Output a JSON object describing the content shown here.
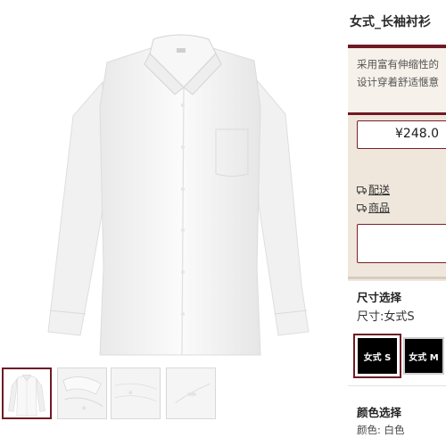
{
  "product": {
    "title": "女式_长袖衬衫",
    "description_line1": "采用富有伸缩性的",
    "description_line2": "设计穿着舒适惬意",
    "price": "¥248.0"
  },
  "links": [
    {
      "icon": "truck-icon",
      "label": "配送"
    },
    {
      "icon": "box-icon",
      "label": "商品"
    }
  ],
  "size": {
    "heading": "尺寸选择",
    "current": "尺寸:女式S",
    "options": [
      "女式 S",
      "女式 M"
    ],
    "selected": "女式 S"
  },
  "color": {
    "heading": "颜色选择",
    "current": "颜色: 白色"
  },
  "gallery": {
    "thumbnail_count": 4,
    "active_thumbnail": 1
  },
  "colors": {
    "accent": "#6e1a26",
    "panel_bg": "#efe7dc",
    "desc_bg": "#f6f1ea"
  }
}
